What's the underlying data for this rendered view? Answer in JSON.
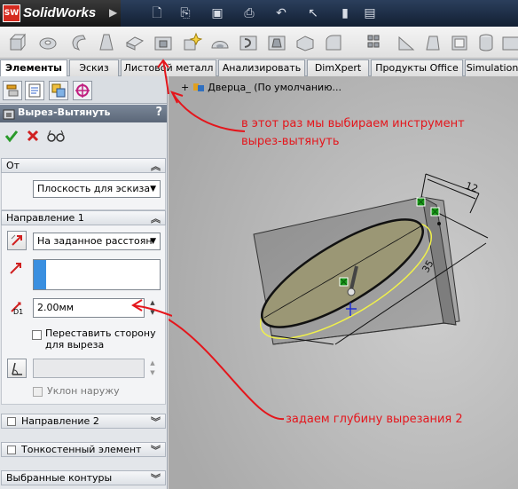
{
  "app": {
    "name": "SolidWorks",
    "logo_mark": "SW"
  },
  "tabs": [
    {
      "label": "Элементы",
      "active": true
    },
    {
      "label": "Эскиз"
    },
    {
      "label": "Листовой металл"
    },
    {
      "label": "Анализировать"
    },
    {
      "label": "DimXpert"
    },
    {
      "label": "Продукты Office"
    },
    {
      "label": "Simulation"
    }
  ],
  "feature": {
    "title": "Вырез-Вытянуть",
    "help": "?",
    "ok_icon": "check-icon",
    "cancel_icon": "x-icon",
    "preview_icon": "glasses-icon"
  },
  "groups": {
    "from": {
      "label": "От",
      "value": "Плоскость для эскиза"
    },
    "direction1": {
      "label": "Направление 1",
      "end_condition": "На заданное расстоян",
      "depth_label": "D1",
      "depth": "2.00мм",
      "flip_side_label": "Переставить сторону для выреза",
      "flip_line1": "Переставить сторону",
      "flip_line2": "для выреза",
      "draft_outward": "Уклон наружу"
    },
    "direction2": {
      "label": "Направление 2"
    },
    "thin": {
      "label": "Тонкостенный элемент"
    },
    "contours": {
      "label": "Выбранные контуры"
    }
  },
  "tree": {
    "item": "Дверца_ (По умолчанию..."
  },
  "dimensions": {
    "width": "12",
    "length": "35"
  },
  "annotations": {
    "top_line1": "в этот раз мы выбираем инструмент",
    "top_line2": "вырез-вытянуть",
    "bottom": "задаем глубину вырезания 2"
  },
  "colors": {
    "annotation": "#e4161c",
    "title_bar": "#1c2a40",
    "pm_title": "#6a7686",
    "sketch": "#e8e84a"
  }
}
